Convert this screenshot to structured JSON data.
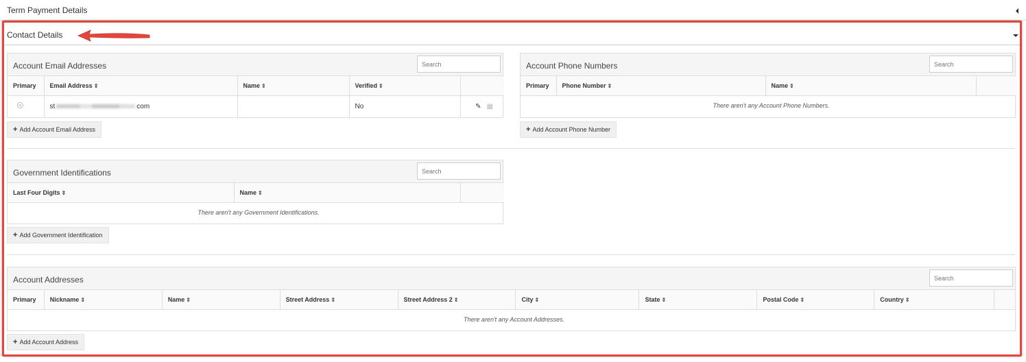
{
  "term_section": {
    "title": "Term Payment Details"
  },
  "contact_section": {
    "title": "Contact Details"
  },
  "search_placeholder": "Search",
  "add_prefix": "+",
  "email_panel": {
    "title": "Account Email Addresses",
    "columns": [
      "Primary",
      "Email Address",
      "Name",
      "Verified",
      ""
    ],
    "rows": [
      {
        "email_start": "st",
        "email_end": "com",
        "name": "",
        "verified": "No"
      }
    ],
    "add_label": "Add Account Email Address"
  },
  "phone_panel": {
    "title": "Account Phone Numbers",
    "columns": [
      "Primary",
      "Phone Number",
      "Name",
      ""
    ],
    "empty": "There aren't any Account Phone Numbers.",
    "add_label": "Add Account Phone Number"
  },
  "gov_panel": {
    "title": "Government Identifications",
    "columns": [
      "Last Four Digits",
      "Name",
      ""
    ],
    "empty": "There aren't any Government Identifications.",
    "add_label": "Add Government Identification"
  },
  "address_panel": {
    "title": "Account Addresses",
    "columns": [
      "Primary",
      "Nickname",
      "Name",
      "Street Address",
      "Street Address 2",
      "City",
      "State",
      "Postal Code",
      "Country",
      ""
    ],
    "empty": "There aren't any Account Addresses.",
    "add_label": "Add Account Address"
  },
  "sort_icon": "sort-icon",
  "accent_color": "#e2463c"
}
